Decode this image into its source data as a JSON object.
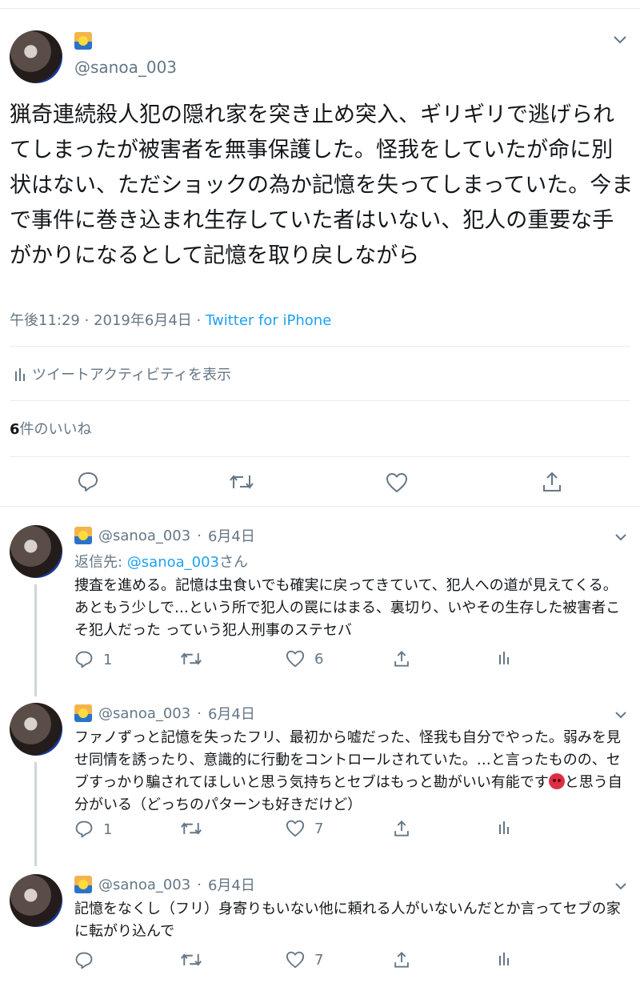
{
  "main_tweet": {
    "handle": "@sanoa_003",
    "text": "猟奇連続殺人犯の隠れ家を突き止め突入、ギリギリで逃げられてしまったが被害者を無事保護した。怪我をしていたが命に別状はない、ただショックの為か記憶を失ってしまっていた。今まで事件に巻き込まれ生存していた者はいない、犯人の重要な手がかりになるとして記憶を取り戻しながら",
    "time": "午後11:29",
    "date": "2019年6月4日",
    "separator": "·",
    "source": "Twitter for iPhone",
    "activity_label": "ツイートアクティビティを表示",
    "likes_count": "6",
    "likes_label": "件のいいね"
  },
  "replies": [
    {
      "handle": "@sanoa_003",
      "date": "6月4日",
      "reply_to_prefix": "返信先: ",
      "reply_to_link": "@sanoa_003",
      "reply_to_suffix": "さん",
      "text": "捜査を進める。記憶は虫食いでも確実に戻ってきていて、犯人への道が見えてくる。あともう少しで…という所で犯人の罠にはまる、裏切り、いやその生存した被害者こそ犯人だった っていう犯人刑事のステセバ",
      "reply_count": "1",
      "like_count": "6"
    },
    {
      "handle": "@sanoa_003",
      "date": "6月4日",
      "text_before_emoji": "ファノずっと記憶を失ったフリ、最初から嘘だった、怪我も自分でやった。弱みを見せ同情を誘ったり、意識的に行動をコントロールされていた。…と言ったものの、セブすっかり騙されてほしいと思う気持ちとセブはもっと勘がいい有能です",
      "text_after_emoji": "と思う自分がいる（どっちのパターンも好きだけど）",
      "reply_count": "1",
      "like_count": "7"
    },
    {
      "handle": "@sanoa_003",
      "date": "6月4日",
      "text": "記憶をなくし（フリ）身寄りもいない他に頼れる人がいないんだとか言ってセブの家に転がり込んで",
      "reply_count": "",
      "like_count": "7"
    }
  ],
  "icons": [
    "sunrise-emoji",
    "chevron-down-icon",
    "stats-icon",
    "reply-icon",
    "retweet-icon",
    "like-icon",
    "share-icon",
    "angry-face-emoji"
  ],
  "colors": {
    "accent": "#1da1f2",
    "secondary_text": "#657786",
    "divider": "#e6ecf0",
    "thread_line": "#ccd6dd"
  }
}
